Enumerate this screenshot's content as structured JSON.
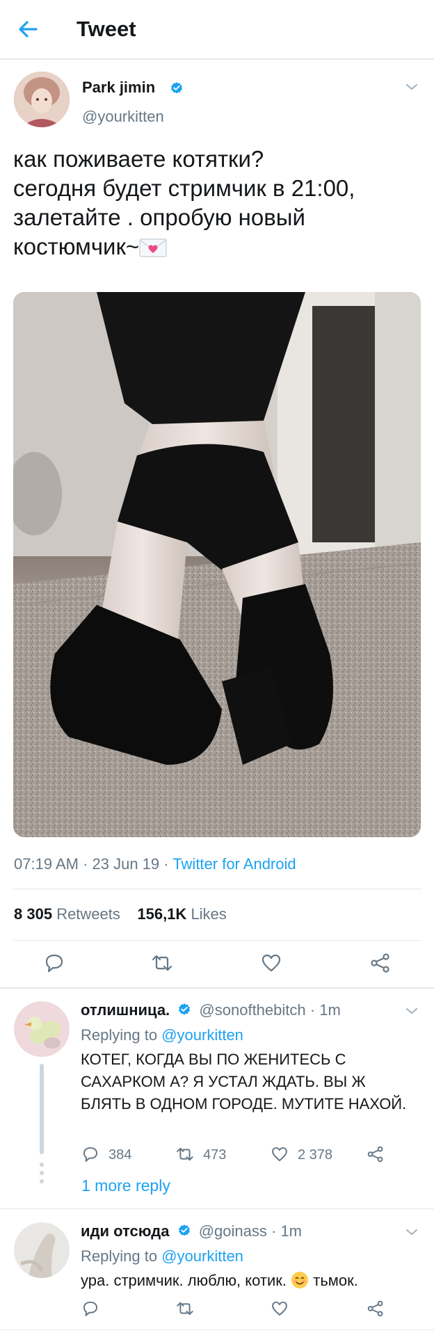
{
  "header": {
    "title": "Tweet",
    "back_icon": "back-arrow-icon"
  },
  "tweet": {
    "author_name": "Park jimin",
    "author_handle": "@yourkitten",
    "text_lines": [
      "как поживаете котятки?",
      "сегодня будет стримчик в 21:00,",
      "залетайте . опробую новый",
      "костюмчик~"
    ],
    "time": "07:19 AM",
    "date": "23 Jun 19",
    "source": "Twitter for Android",
    "retweets_count": "8 305",
    "retweets_label": "Retweets",
    "likes_count": "156,1K",
    "likes_label": "Likes"
  },
  "replies": [
    {
      "name": "отлишница.",
      "handle": "@sonofthebitch",
      "time": "1m",
      "replying_to_label": "Replying to",
      "replying_to": "@yourkitten",
      "text": "КОТЕГ, КОГДА ВЫ ПО ЖЕНИТЕСЬ С САХАРКОМ А? Я УСТАЛ ЖДАТЬ. ВЫ Ж БЛЯТЬ В ОДНОМ ГОРОДЕ. МУТИТЕ НАХОЙ.",
      "reply_count": "384",
      "retweet_count": "473",
      "like_count": "2 378",
      "more_replies": "1 more reply"
    },
    {
      "name": "иди отсюда",
      "handle": "@goinass",
      "time": "1m",
      "replying_to_label": "Replying to",
      "replying_to": "@yourkitten",
      "text_before_emoji": "ура. стримчик. люблю, котик.",
      "text_after_emoji": "тьмок."
    }
  ],
  "colors": {
    "accent": "#1da1f2",
    "text_primary": "#14171a",
    "text_secondary": "#657786",
    "divider": "#e1e8ed"
  },
  "icons": [
    "back-arrow-icon",
    "verified-badge-icon",
    "chevron-down-icon",
    "reply-icon",
    "retweet-icon",
    "like-icon",
    "share-icon",
    "envelope-heart-emoji",
    "smiling-face-emoji"
  ]
}
